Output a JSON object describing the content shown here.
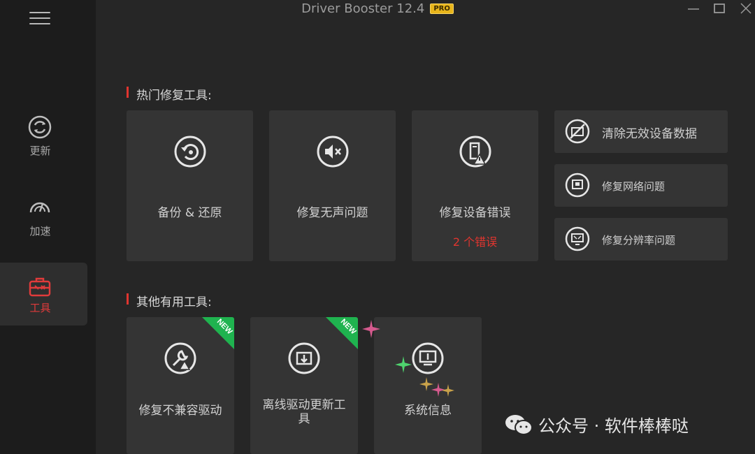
{
  "window": {
    "title": "Driver Booster 12.4",
    "badge": "PRO"
  },
  "sidebar": {
    "items": [
      {
        "label": "更新",
        "icon": "update-icon"
      },
      {
        "label": "加速",
        "icon": "speedometer-icon"
      },
      {
        "label": "工具",
        "icon": "toolbox-icon",
        "active": true
      }
    ]
  },
  "hot_tools": {
    "heading": "热门修复工具:",
    "cards": [
      {
        "label": "备份 & 还原",
        "icon": "backup-restore-icon"
      },
      {
        "label": "修复无声问题",
        "icon": "speaker-mute-icon"
      },
      {
        "label": "修复设备错误",
        "icon": "device-error-icon",
        "sub": "2 个错误"
      }
    ],
    "side": [
      {
        "label": "清除无效设备数据",
        "icon": "clean-device-icon"
      },
      {
        "label": "修复网络问题",
        "icon": "network-icon"
      },
      {
        "label": "修复分辨率问题",
        "icon": "resolution-icon"
      }
    ]
  },
  "other_tools": {
    "heading": "其他有用工具:",
    "cards": [
      {
        "label": "修复不兼容驱动",
        "icon": "wrench-warning-icon",
        "new": "NEW"
      },
      {
        "label": "离线驱动更新工具",
        "icon": "offline-driver-icon",
        "new": "NEW"
      },
      {
        "label": "系统信息",
        "icon": "system-info-icon"
      }
    ]
  },
  "watermark": {
    "text": "公众号 · 软件棒棒哒"
  },
  "colors": {
    "accent": "#e0352f",
    "new_badge": "#1fb34f",
    "pro_badge": "#e8b51b"
  }
}
